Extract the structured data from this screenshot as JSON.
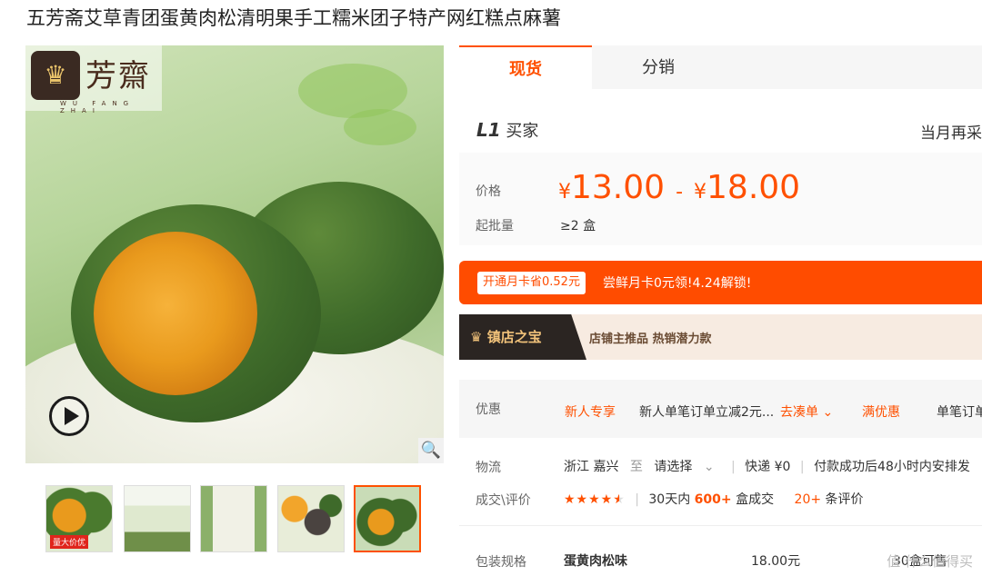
{
  "product": {
    "title": "五芳斋艾草青团蛋黄肉松清明果手工糯米团子特产网红糕点麻薯"
  },
  "gallery": {
    "logo_name": "芳齋",
    "logo_sub": "WU FANG ZHAI",
    "thumb1_badge": "量大价优"
  },
  "tabs": [
    {
      "label": "现货"
    },
    {
      "label": "分销"
    }
  ],
  "buyer": {
    "level_prefix": "L1",
    "level_text": "买家",
    "monthly_text": "当月再采"
  },
  "pricing": {
    "price_label": "价格",
    "currency": "¥",
    "price_min": "13.00",
    "dash": "-",
    "price_max": "18.00",
    "moq_label": "起批量",
    "moq_value": "≥2 盒"
  },
  "promo": {
    "card_text": "开通月卡省0.52元",
    "text": "尝鲜月卡0元领!4.24解锁!"
  },
  "treasure": {
    "tag_icon": "crown-icon",
    "tag_text": "镇店之宝",
    "desc": "店铺主推品   热销潜力款"
  },
  "discount": {
    "label": "优惠",
    "new_user_tag": "新人专享",
    "new_user_text": "新人单笔订单立减2元...",
    "collect_link": "去凑单",
    "full_discount_tag": "满优惠",
    "full_discount_text": "单笔订单"
  },
  "logistics": {
    "label": "物流",
    "origin": "浙江 嘉兴",
    "to": "至",
    "destination": "请选择",
    "express": "快递 ¥0",
    "shipping": "付款成功后48小时内安排发"
  },
  "reviews": {
    "label": "成交\\评价",
    "rating": 4.5,
    "days_text": "30天内",
    "deals_count": "600+",
    "deals_unit": "盒成交",
    "review_count": "20+",
    "review_unit": "条评价"
  },
  "spec": {
    "label": "包装规格",
    "name": "蛋黄肉松味",
    "price": "18.00元",
    "stock": "30盒可售"
  },
  "watermark": "值 什么值得买",
  "colors": {
    "accent": "#ff5000",
    "promo_bg": "#ff4c00",
    "treasure_bg": "#f7ebe1",
    "treasure_tag_bg": "#2b2522"
  }
}
